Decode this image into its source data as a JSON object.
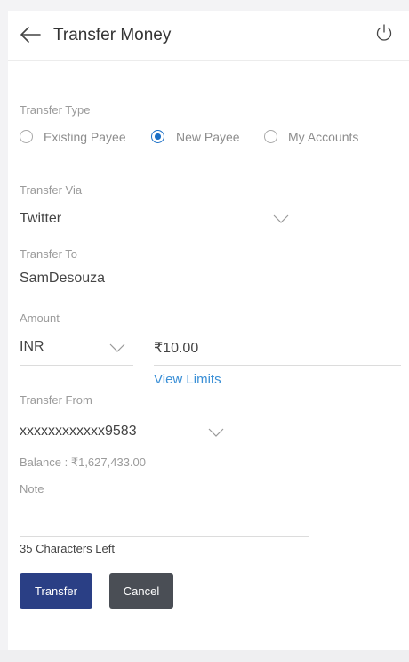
{
  "header": {
    "title": "Transfer Money",
    "back_icon": "arrow-left-icon",
    "logout_icon": "power-icon"
  },
  "transfer_type": {
    "label": "Transfer Type",
    "options": [
      {
        "label": "Existing Payee",
        "selected": false
      },
      {
        "label": "New Payee",
        "selected": true
      },
      {
        "label": "My Accounts",
        "selected": false
      }
    ]
  },
  "transfer_via": {
    "label": "Transfer Via",
    "value": "Twitter"
  },
  "transfer_to": {
    "label": "Transfer To",
    "value": "SamDesouza"
  },
  "amount": {
    "label": "Amount",
    "currency": "INR",
    "value": "₹10.00",
    "view_limits": "View Limits"
  },
  "transfer_from": {
    "label": "Transfer From",
    "value": "xxxxxxxxxxxx9583",
    "balance": "Balance : ₹1,627,433.00"
  },
  "note": {
    "label": "Note",
    "value": "",
    "chars_left": "35 Characters Left"
  },
  "actions": {
    "transfer": "Transfer",
    "cancel": "Cancel"
  },
  "colors": {
    "accent": "#1a6fc6",
    "primary_button": "#2a3f85",
    "secondary_button": "#4a4e55",
    "link": "#3a8fd6"
  }
}
